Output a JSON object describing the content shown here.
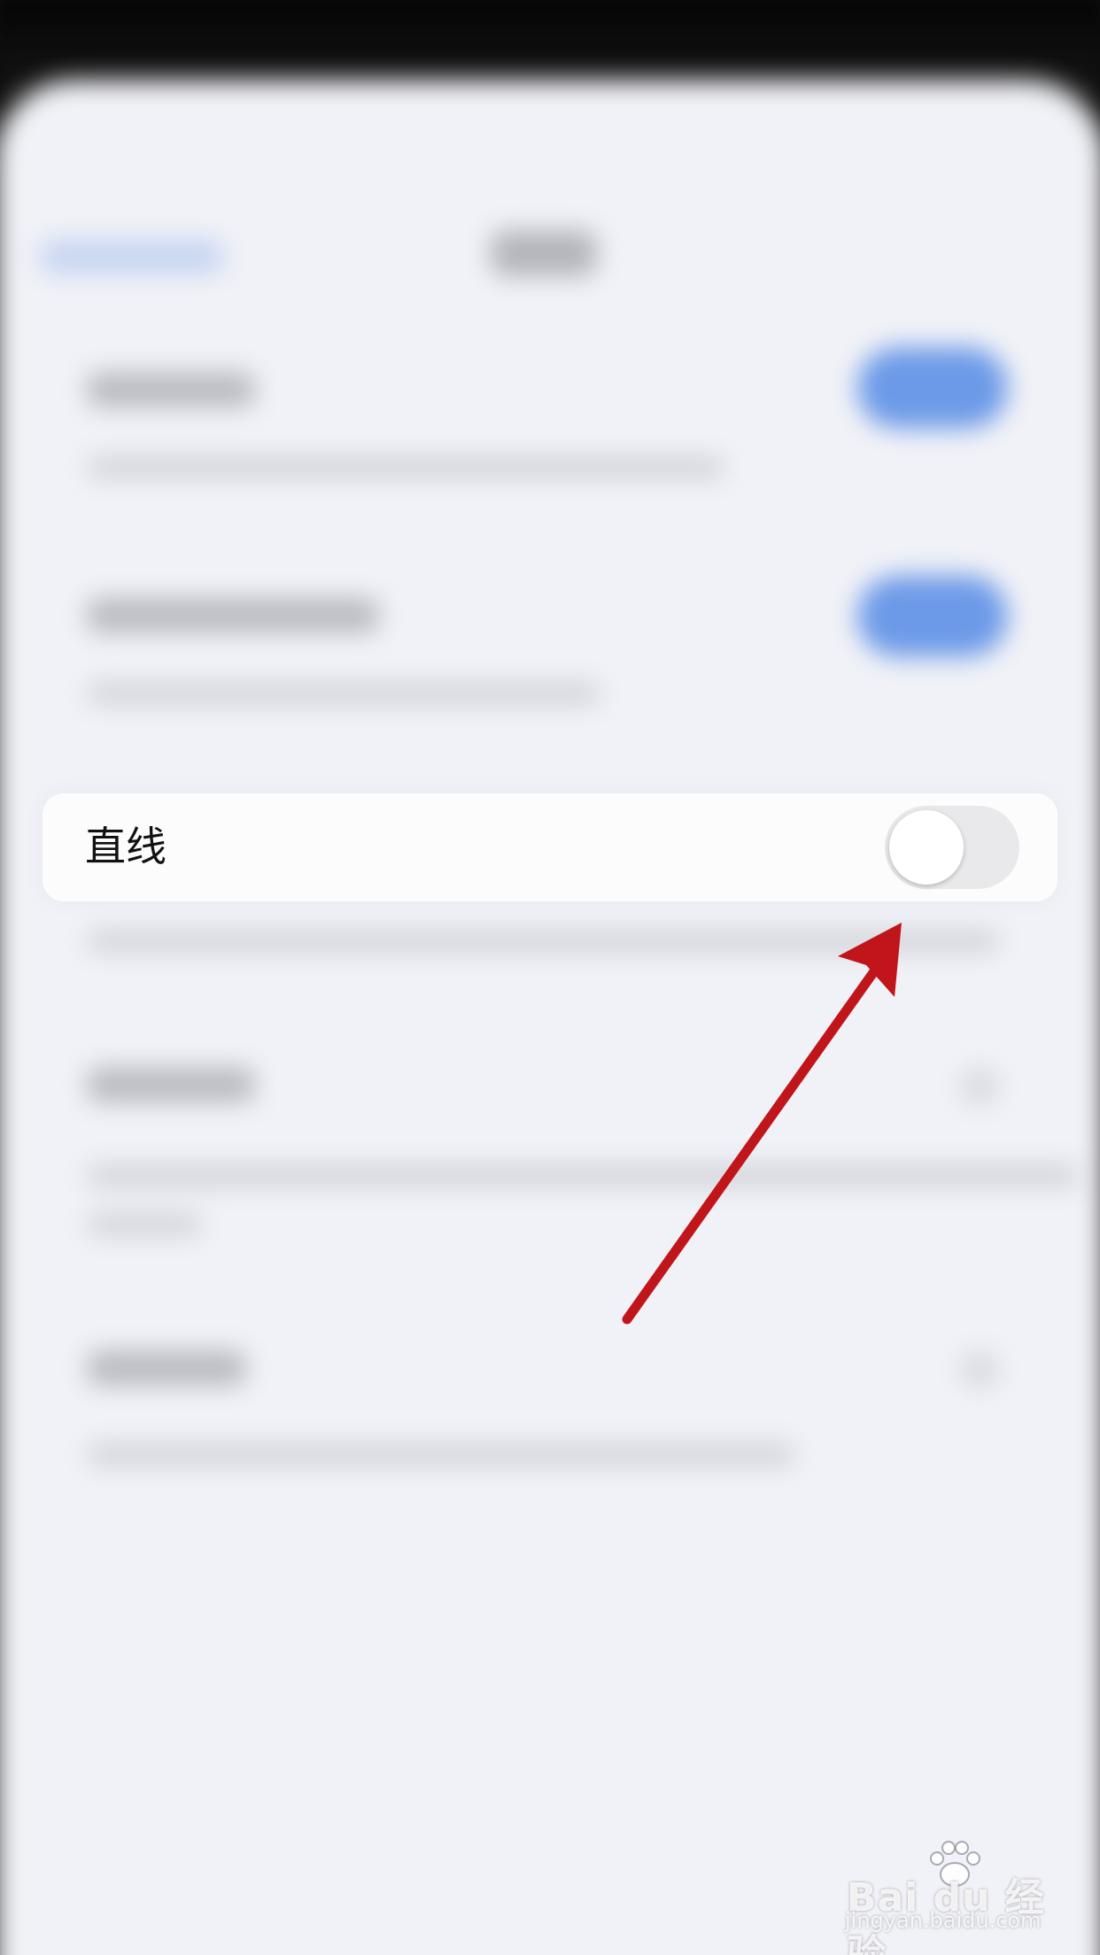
{
  "setting_row": {
    "label": "直线",
    "toggle_on": false
  },
  "watermark": {
    "logo_text": "Bai du 经验",
    "url": "jingyan.baidu.com"
  },
  "colors": {
    "toggle_on_bg": "#6c9ae8",
    "toggle_off_bg": "#e9e9eb",
    "arrow": "#c0151a",
    "sheet_bg": "#f1f2f7"
  },
  "icons": [
    "annotation-arrow-icon",
    "baidu-paw-icon"
  ]
}
